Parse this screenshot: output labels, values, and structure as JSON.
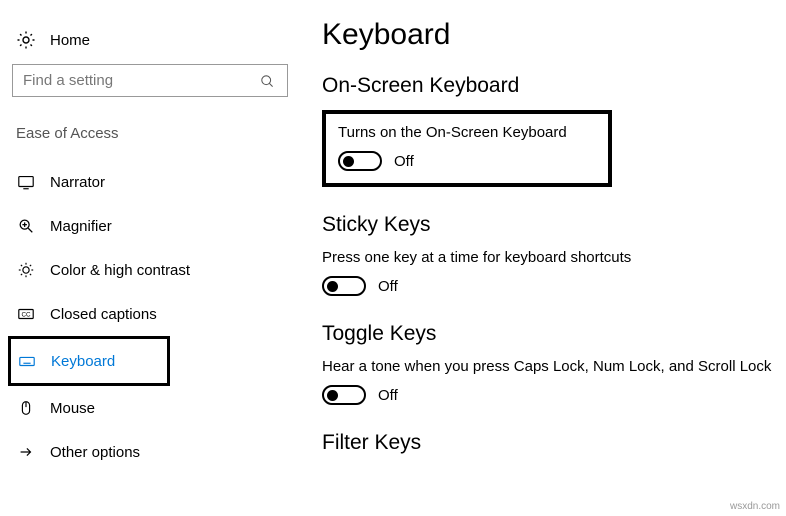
{
  "sidebar": {
    "home_label": "Home",
    "search_placeholder": "Find a setting",
    "section_header": "Ease of Access",
    "items": [
      {
        "label": "Narrator"
      },
      {
        "label": "Magnifier"
      },
      {
        "label": "Color & high contrast"
      },
      {
        "label": "Closed captions"
      },
      {
        "label": "Keyboard"
      },
      {
        "label": "Mouse"
      },
      {
        "label": "Other options"
      }
    ]
  },
  "content": {
    "page_title": "Keyboard",
    "onscreen": {
      "title": "On-Screen Keyboard",
      "desc": "Turns on the On-Screen Keyboard",
      "state": "Off"
    },
    "sticky": {
      "title": "Sticky Keys",
      "desc": "Press one key at a time for keyboard shortcuts",
      "state": "Off"
    },
    "toggle": {
      "title": "Toggle Keys",
      "desc": "Hear a tone when you press Caps Lock, Num Lock, and Scroll Lock",
      "state": "Off"
    },
    "filter": {
      "title": "Filter Keys"
    }
  },
  "watermark": "wsxdn.com"
}
